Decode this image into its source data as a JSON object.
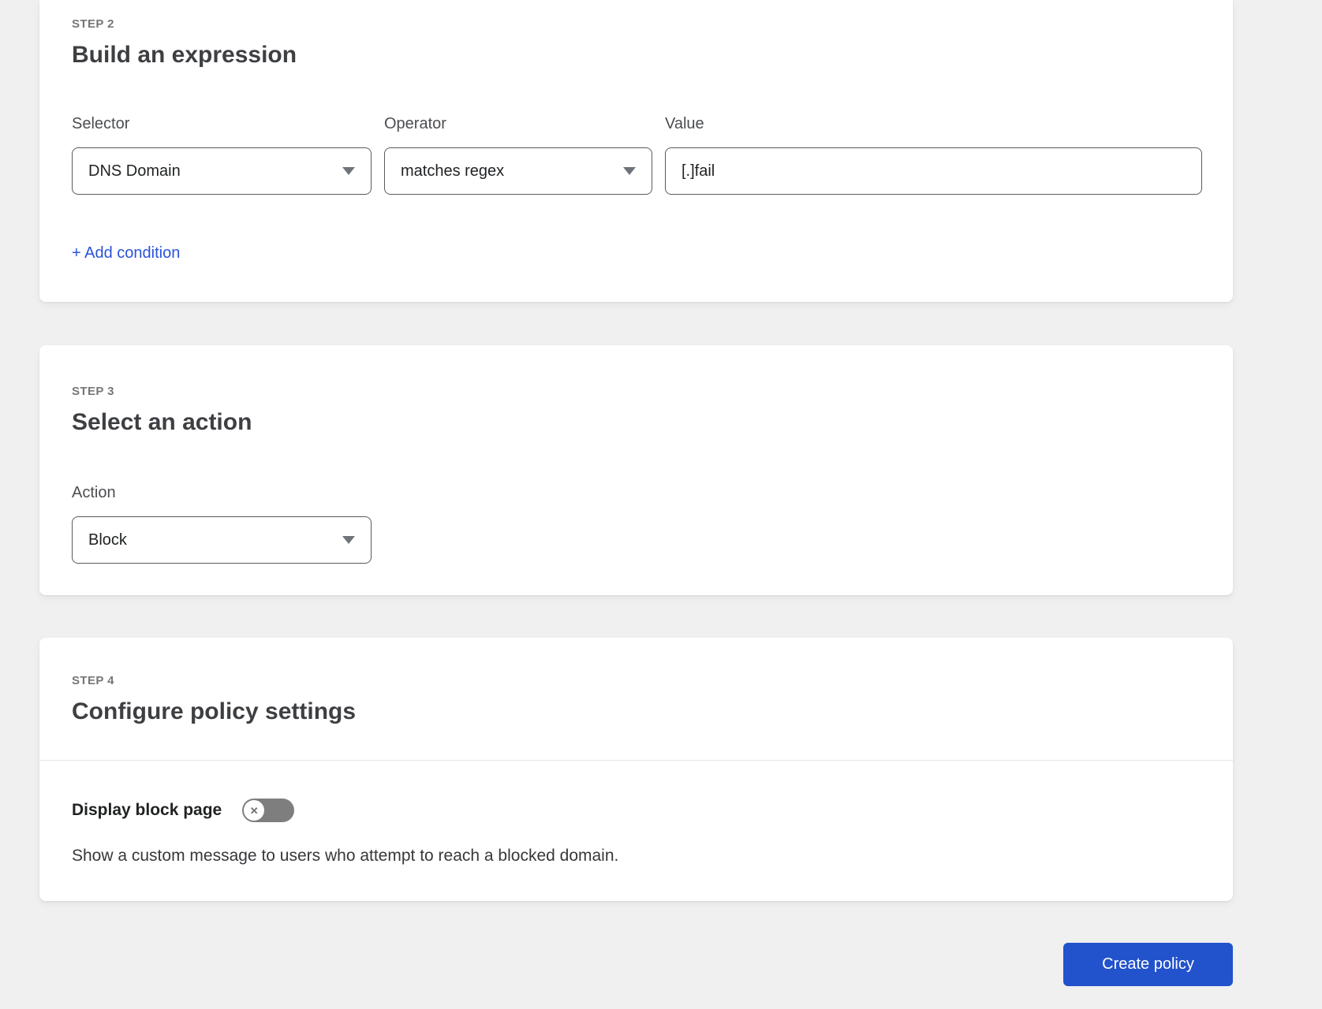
{
  "page": {
    "background_color": "#f0f0f0",
    "card_color": "#ffffff",
    "link_blue": "#2a53d8",
    "button_blue": "#2252cc"
  },
  "steps": {
    "step2": {
      "eyebrow": "STEP 2",
      "title": "Build an expression",
      "fields": [
        {
          "label": "Selector",
          "type": "select",
          "value": "DNS Domain"
        },
        {
          "label": "Operator",
          "type": "select",
          "value": "matches regex"
        },
        {
          "label": "Value",
          "type": "input",
          "value": "[.]fail"
        }
      ],
      "add_condition_label": "+ Add condition"
    },
    "step3": {
      "eyebrow": "STEP 3",
      "title": "Select an action",
      "action_label": "Action",
      "action_value": "Block"
    },
    "step4": {
      "eyebrow": "STEP 4",
      "title": "Configure policy settings",
      "toggle_label": "Display block page",
      "toggle_state": "off",
      "toggle_knob_glyph": "✕",
      "description": "Show a custom message to users who attempt to reach a blocked domain."
    }
  },
  "footer": {
    "create_button_label": "Create policy"
  },
  "icons": {
    "select_caret": "chevron-down",
    "toggle_knob": "x-circle"
  }
}
